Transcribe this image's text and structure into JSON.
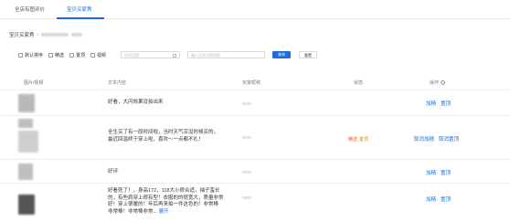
{
  "tabs": [
    {
      "label": "全店有图评价"
    },
    {
      "label": "宝贝买家秀",
      "active": true
    }
  ],
  "breadcrumb": {
    "label": "宝贝买家秀"
  },
  "filters": {
    "checkboxes": [
      {
        "label": "默认排序"
      },
      {
        "label": "精选"
      },
      {
        "label": "置顶"
      },
      {
        "label": "视频"
      }
    ],
    "date_placeholder": "时间范围",
    "search_placeholder": "输入文本内容搜索",
    "search_button": "查询",
    "reset_button": "重置"
  },
  "table": {
    "headers": {
      "image_video": "图片/视频",
      "text": "文本内容",
      "nickname": "买家昵称",
      "status": "状态",
      "actions": "操作"
    },
    "rows": [
      {
        "text_lines": [
          "好看，大闪效果没拍出来"
        ],
        "status_featured": "",
        "status_top": "",
        "actions": [
          "加精",
          "置顶"
        ]
      },
      {
        "text_lines": [
          "全生买了有一段时间啦，当时天气凉没时候买的，",
          "最近回温终于穿上啦，喜欢～一点都不扎！"
        ],
        "status_featured": "精选",
        "status_top": "置顶",
        "actions": [
          "取消加精",
          "取消置顶"
        ]
      },
      {
        "text_lines": [
          "好评"
        ],
        "status_featured": "",
        "status_top": "",
        "actions": [
          "加精",
          "置顶"
        ]
      },
      {
        "text_lines": [
          "好看死了！，身高172，118大小很合适，袖子蛮长",
          "的，有些肩穿上很有型！衣服的的很宽大，质量非常",
          "好！穿上很暖的！年后再来拍一件这色的！非常棒",
          "非常棒！非常棒非常..."
        ],
        "expand_label": "展开",
        "status_featured": "",
        "status_top": "",
        "actions": [
          "加精",
          "置顶"
        ]
      }
    ]
  }
}
